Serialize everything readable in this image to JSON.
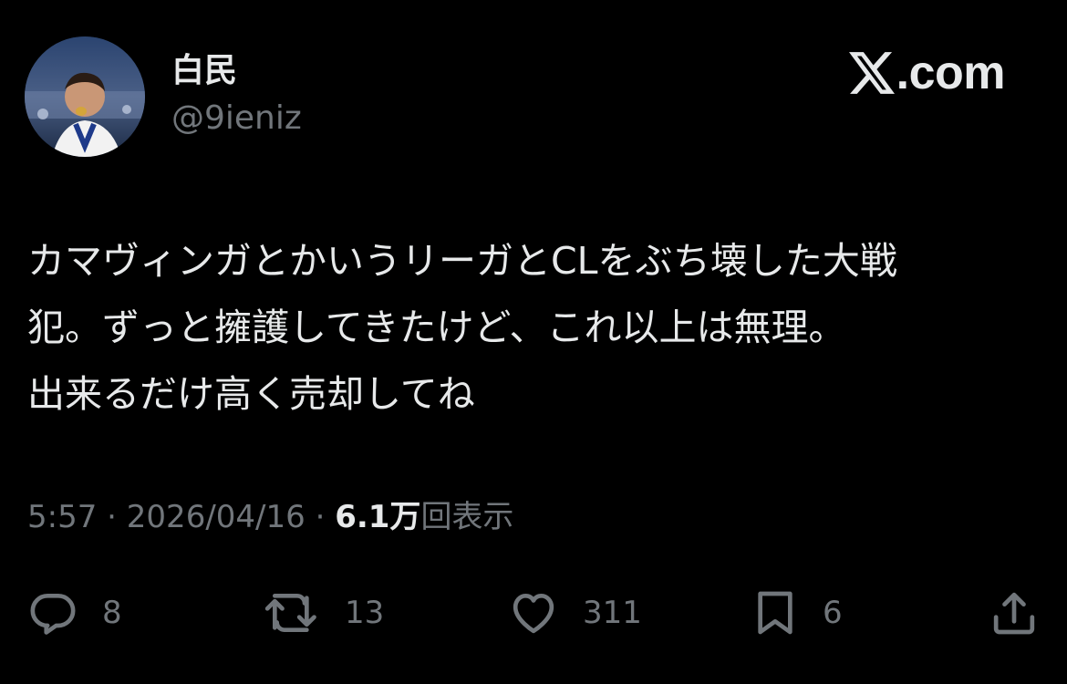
{
  "user": {
    "display_name": "白民",
    "handle": "@9ieniz",
    "avatar_icon": "avatar-photo"
  },
  "brand": {
    "text": ".com",
    "logo_icon": "x-logo-icon"
  },
  "tweet": {
    "lines": [
      "カマヴィンガとかいうリーガとCLをぶち壊した大戦",
      "犯。ずっと擁護してきたけど、これ以上は無理。",
      "出来るだけ高く売却してね"
    ],
    "time": "5:57",
    "sep1": " · ",
    "date": "2026/04/16",
    "sep2": " · ",
    "views_count": "6.1万",
    "views_label": "回表示"
  },
  "actions": {
    "reply": {
      "icon": "reply-icon",
      "count": "8"
    },
    "repost": {
      "icon": "repost-icon",
      "count": "13"
    },
    "like": {
      "icon": "heart-icon",
      "count": "311"
    },
    "bookmark": {
      "icon": "bookmark-icon",
      "count": "6"
    },
    "share": {
      "icon": "share-icon"
    }
  },
  "colors": {
    "background": "#000000",
    "primary_text": "#e7e9ea",
    "secondary_text": "#71767b"
  }
}
